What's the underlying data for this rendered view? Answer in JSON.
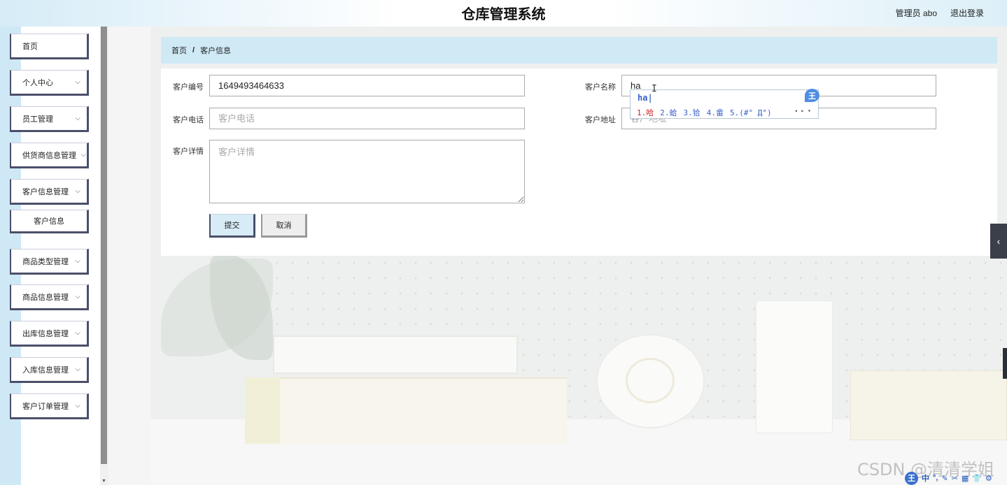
{
  "header": {
    "title": "仓库管理系统",
    "user": "管理员 abo",
    "logout": "退出登录"
  },
  "sidebar": {
    "items": [
      {
        "label": "首页",
        "expandable": false
      },
      {
        "label": "个人中心",
        "expandable": true
      },
      {
        "label": "员工管理",
        "expandable": true
      },
      {
        "label": "供货商信息管理",
        "expandable": true
      },
      {
        "label": "客户信息管理",
        "expandable": true
      },
      {
        "label": "商品类型管理",
        "expandable": true
      },
      {
        "label": "商品信息管理",
        "expandable": true
      },
      {
        "label": "出库信息管理",
        "expandable": true
      },
      {
        "label": "入库信息管理",
        "expandable": true
      },
      {
        "label": "客户订单管理",
        "expandable": true
      }
    ],
    "subitem": "客户信息",
    "chevron": "⌵"
  },
  "breadcrumb": {
    "home": "首页",
    "separator": "/",
    "current": "客户信息"
  },
  "form": {
    "id_label": "客户编号",
    "id_value": "1649493464633",
    "name_label": "客户名称",
    "name_value": "ha",
    "phone_label": "客户电话",
    "phone_placeholder": "客户电话",
    "address_label": "客户地址",
    "address_placeholder": "客户地址",
    "detail_label": "客户详情",
    "detail_placeholder": "客户详情",
    "submit": "提交",
    "cancel": "取消"
  },
  "ime": {
    "composition": "ha|",
    "candidates": [
      "1.哈",
      "2.蛤",
      "3.铪",
      "4.畲",
      "5.(#° Д°)"
    ],
    "badge": "王",
    "pager": "◂ ▸ ▾"
  },
  "watermark": "CSDN @清清学姐",
  "ime_toolbar": {
    "logo": "王",
    "tools": [
      "中",
      "°,",
      "✎",
      "✂",
      "▦",
      "👕",
      "⚙"
    ]
  },
  "collapse_tab": "‹"
}
